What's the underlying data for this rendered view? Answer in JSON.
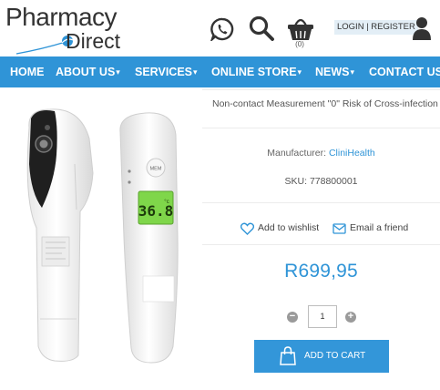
{
  "header": {
    "logo_top": "Pharmacy",
    "logo_bottom": "Direct",
    "basket_count": "(0)",
    "login_label": "LOGIN | REGISTER"
  },
  "nav": {
    "items": [
      {
        "label": "HOME",
        "has_dropdown": false
      },
      {
        "label": "ABOUT US",
        "has_dropdown": true
      },
      {
        "label": "SERVICES",
        "has_dropdown": true
      },
      {
        "label": "ONLINE STORE",
        "has_dropdown": true
      },
      {
        "label": "NEWS",
        "has_dropdown": true
      },
      {
        "label": "CONTACT US",
        "has_dropdown": false
      }
    ],
    "chevron": "❯"
  },
  "product": {
    "description_snippet": "Non-contact Measurement \"0\" Risk of Cross-infection",
    "manufacturer_label": "Manufacturer:",
    "manufacturer_value": "CliniHealth",
    "sku_label": "SKU:",
    "sku_value": "778800001",
    "wishlist_label": "Add to wishlist",
    "email_label": "Email a friend",
    "price": "R699,95",
    "quantity": "1",
    "add_to_cart_label": "ADD TO CART",
    "thermometer_display": "36.8°c",
    "thermometer_button": "MEM"
  },
  "colors": {
    "brand_blue": "#2f94d7",
    "nav_bg": "#2f94d7",
    "price": "#2f94d7",
    "button_bg": "#3396d9",
    "display_green": "#7fd64a"
  }
}
